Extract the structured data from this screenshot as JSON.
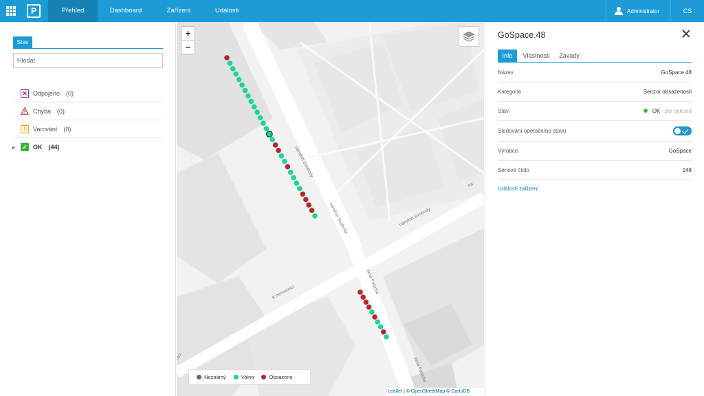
{
  "topbar": {
    "nav": [
      {
        "label": "Přehled",
        "active": true
      },
      {
        "label": "Dashboard",
        "active": false
      },
      {
        "label": "Zařízení",
        "active": false
      },
      {
        "label": "Události",
        "active": false
      }
    ],
    "logo_letter": "P",
    "user": "Administrator",
    "lang": "CS",
    "accent": "#1c9bd6"
  },
  "sidebar": {
    "tab": "Stav",
    "search_placeholder": "Hledat",
    "statuses": [
      {
        "icon": "disconnected-icon",
        "label": "Odpojeno",
        "count": "(0)"
      },
      {
        "icon": "error-triangle-icon",
        "label": "Chyba",
        "count": "(0)"
      },
      {
        "icon": "warning-icon",
        "label": "Varování",
        "count": "(0)"
      },
      {
        "icon": "ok-check-icon",
        "label": "OK",
        "count": "(44)"
      }
    ]
  },
  "map": {
    "zoom_in": "+",
    "zoom_out": "−",
    "streets": [
      "náměstí Svobody",
      "náměstí Svobody",
      "náměstí Svobody",
      "K nemocnici",
      "Jana Palacha",
      "Jana Palacha",
      "nicí",
      "ná"
    ],
    "legend": [
      {
        "label": "Neznámý",
        "color": "#666666"
      },
      {
        "label": "Volno",
        "color": "#1fd39a"
      },
      {
        "label": "Obsazeno",
        "color": "#b22b2b"
      }
    ],
    "attribution": {
      "leaflet": "Leaflet",
      "sep1": " | © ",
      "osm": "OpenStreetMap",
      "sep2": " © ",
      "carto": "CartoDB"
    },
    "row1": [
      "occupied",
      "free",
      "free",
      "free",
      "free",
      "free",
      "free",
      "free",
      "free",
      "free",
      "free",
      "free",
      "free",
      "free",
      "selected",
      "free",
      "occupied",
      "occupied",
      "free",
      "free",
      "occupied",
      "free",
      "free",
      "free",
      "free",
      "occupied",
      "occupied",
      "occupied",
      "occupied",
      "free"
    ],
    "row2": [
      "occupied",
      "occupied",
      "occupied",
      "occupied",
      "free",
      "occupied",
      "free",
      "free",
      "occupied",
      "free"
    ]
  },
  "panel": {
    "title": "GoSpace.48",
    "tabs": [
      {
        "label": "Info",
        "active": true
      },
      {
        "label": "Vlastnosti",
        "active": false
      },
      {
        "label": "Závady",
        "active": false
      }
    ],
    "rows": [
      {
        "key": "Název",
        "value": "GoSpace.48"
      },
      {
        "key": "Kategorie",
        "value": "Senzor obsazenosti"
      },
      {
        "key": "Stav",
        "value": "OK",
        "extra": "pár sekund"
      },
      {
        "key": "Sledování operačního stavu",
        "toggle": true
      },
      {
        "key": "Výrobce",
        "value": "GoSpace"
      },
      {
        "key": "Sériové číslo",
        "value": "148"
      }
    ],
    "link": "Události zařízení"
  }
}
